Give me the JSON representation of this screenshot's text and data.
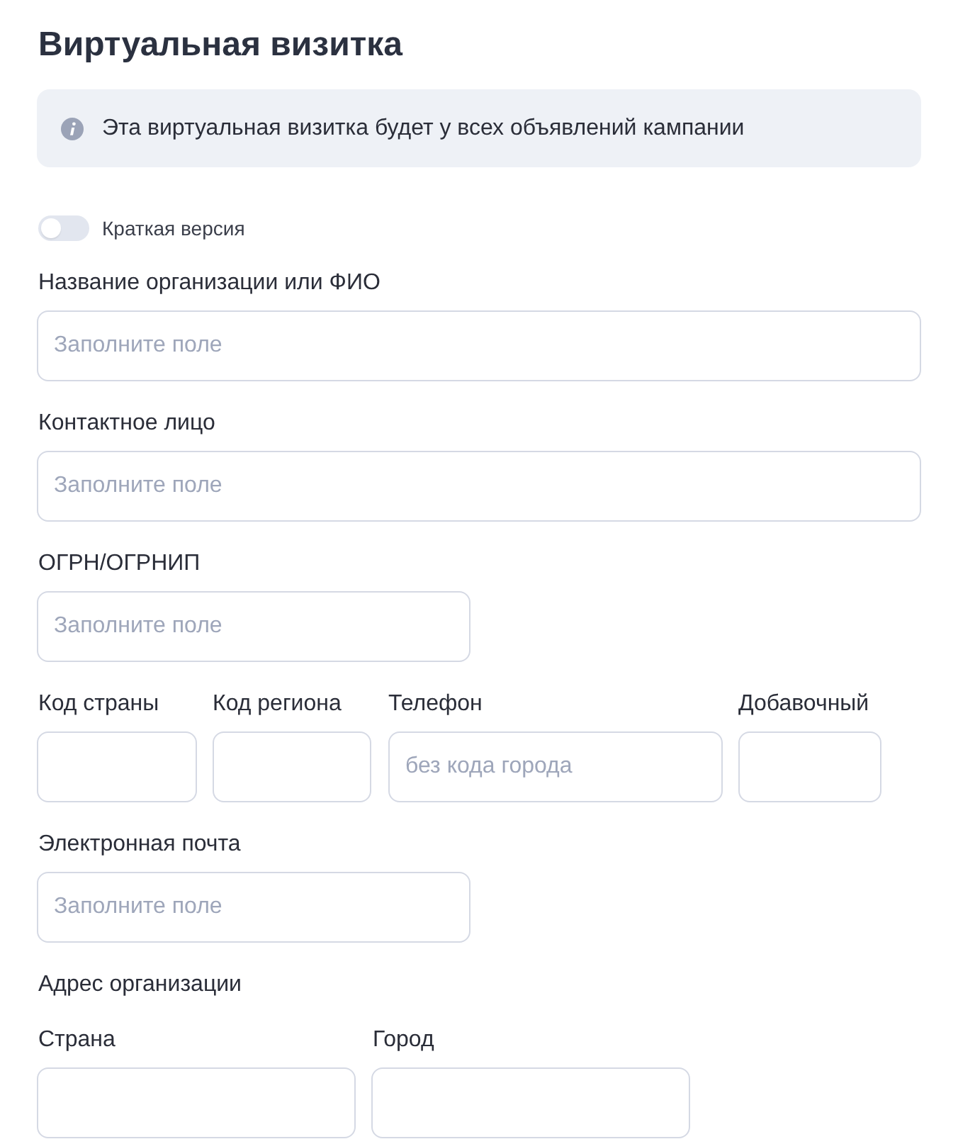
{
  "title": "Виртуальная визитка",
  "notice": {
    "text": "Эта виртуальная визитка будет у всех объявлений кампании"
  },
  "short_version_toggle": {
    "label": "Краткая версия",
    "on": false
  },
  "fields": [
    {
      "label": "Название организации или ФИО",
      "placeholder": "Заполните поле"
    },
    {
      "label": "Контактное лицо",
      "placeholder": "Заполните поле"
    },
    {
      "label": "ОГРН/ОГРНИП",
      "placeholder": "Заполните поле"
    }
  ],
  "phone": [
    {
      "label": "Код страны"
    },
    {
      "label": "Код региона"
    },
    {
      "label": "Телефон",
      "placeholder": "без кода города"
    },
    {
      "label": "Добавочный"
    }
  ],
  "email": {
    "label": "Электронная почта",
    "placeholder": "Заполните поле"
  },
  "address": {
    "heading": "Адрес организации",
    "fields": [
      {
        "label": "Страна"
      },
      {
        "label": "Город"
      }
    ]
  }
}
